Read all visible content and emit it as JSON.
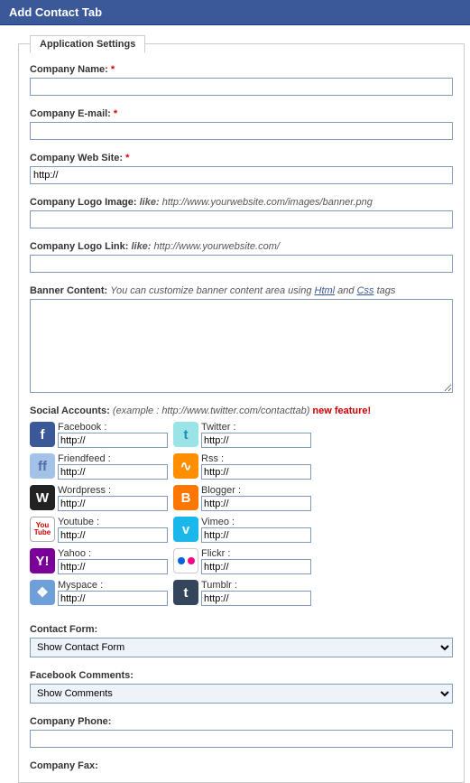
{
  "titlebar": "Add Contact Tab",
  "legend": "Application Settings",
  "fields": {
    "company_name": {
      "label": "Company Name:",
      "required": true,
      "value": ""
    },
    "company_email": {
      "label": "Company E-mail:",
      "required": true,
      "value": ""
    },
    "company_web": {
      "label": "Company Web Site:",
      "required": true,
      "value": "http://"
    },
    "logo_image": {
      "label": "Company Logo Image:",
      "hint_prefix": "like:",
      "hint": "http://www.yourwebsite.com/images/banner.png",
      "value": ""
    },
    "logo_link": {
      "label": "Company Logo Link:",
      "hint_prefix": "like:",
      "hint": "http://www.yourwebsite.com/",
      "value": ""
    },
    "banner": {
      "label": "Banner Content:",
      "hint_pre": "You can customize banner content area using ",
      "hint_link1": "Html",
      "hint_mid": " and ",
      "hint_link2": "Css",
      "hint_post": " tags",
      "value": ""
    },
    "social_label": "Social Accounts:",
    "social_hint": "(example : http://www.twitter.com/contacttab)",
    "social_new": "new feature!",
    "contact_form": {
      "label": "Contact Form:",
      "selected": "Show Contact Form"
    },
    "fb_comments": {
      "label": "Facebook Comments:",
      "selected": "Show Comments"
    },
    "company_phone": {
      "label": "Company Phone:",
      "value": ""
    },
    "company_fax": {
      "label": "Company Fax:",
      "value": ""
    }
  },
  "social": [
    {
      "key": "facebook",
      "label": "Facebook :",
      "value": "http://",
      "glyph": "f"
    },
    {
      "key": "twitter",
      "label": "Twitter :",
      "value": "http://",
      "glyph": "t"
    },
    {
      "key": "friendfeed",
      "label": "Friendfeed :",
      "value": "http://",
      "glyph": "ff"
    },
    {
      "key": "rss",
      "label": "Rss :",
      "value": "http://",
      "glyph": "∿"
    },
    {
      "key": "wordpress",
      "label": "Wordpress :",
      "value": "http://",
      "glyph": "W"
    },
    {
      "key": "blogger",
      "label": "Blogger :",
      "value": "http://",
      "glyph": "B"
    },
    {
      "key": "youtube",
      "label": "Youtube :",
      "value": "http://",
      "glyph": "You Tube"
    },
    {
      "key": "vimeo",
      "label": "Vimeo :",
      "value": "http://",
      "glyph": "v"
    },
    {
      "key": "yahoo",
      "label": "Yahoo :",
      "value": "http://",
      "glyph": "Y!"
    },
    {
      "key": "flickr",
      "label": "Flickr :",
      "value": "http://",
      "glyph": ""
    },
    {
      "key": "myspace",
      "label": "Myspace :",
      "value": "http://",
      "glyph": "❖"
    },
    {
      "key": "tumblr",
      "label": "Tumblr :",
      "value": "http://",
      "glyph": "t"
    }
  ]
}
